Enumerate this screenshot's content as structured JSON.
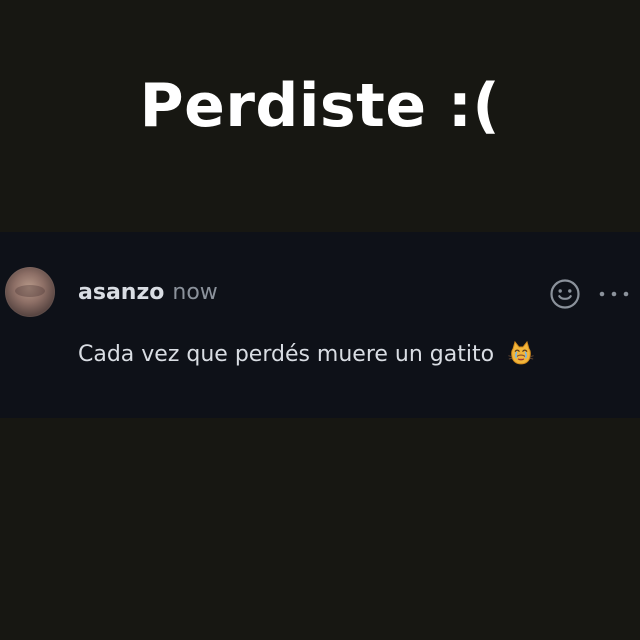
{
  "title": "Perdiste :(",
  "comment": {
    "author": "asanzo",
    "timestamp": "now",
    "text": "Cada vez que perdés muere un gatito",
    "emoji_name": "crying-cat-face",
    "actions": {
      "reaction_icon": "smiley-reaction-icon",
      "more_icon": "more-options-icon"
    }
  },
  "colors": {
    "background": "#171712",
    "panel": "#0e1118",
    "primary_text": "#d9dde3",
    "secondary_text": "#8b929b",
    "title": "#ffffff"
  }
}
